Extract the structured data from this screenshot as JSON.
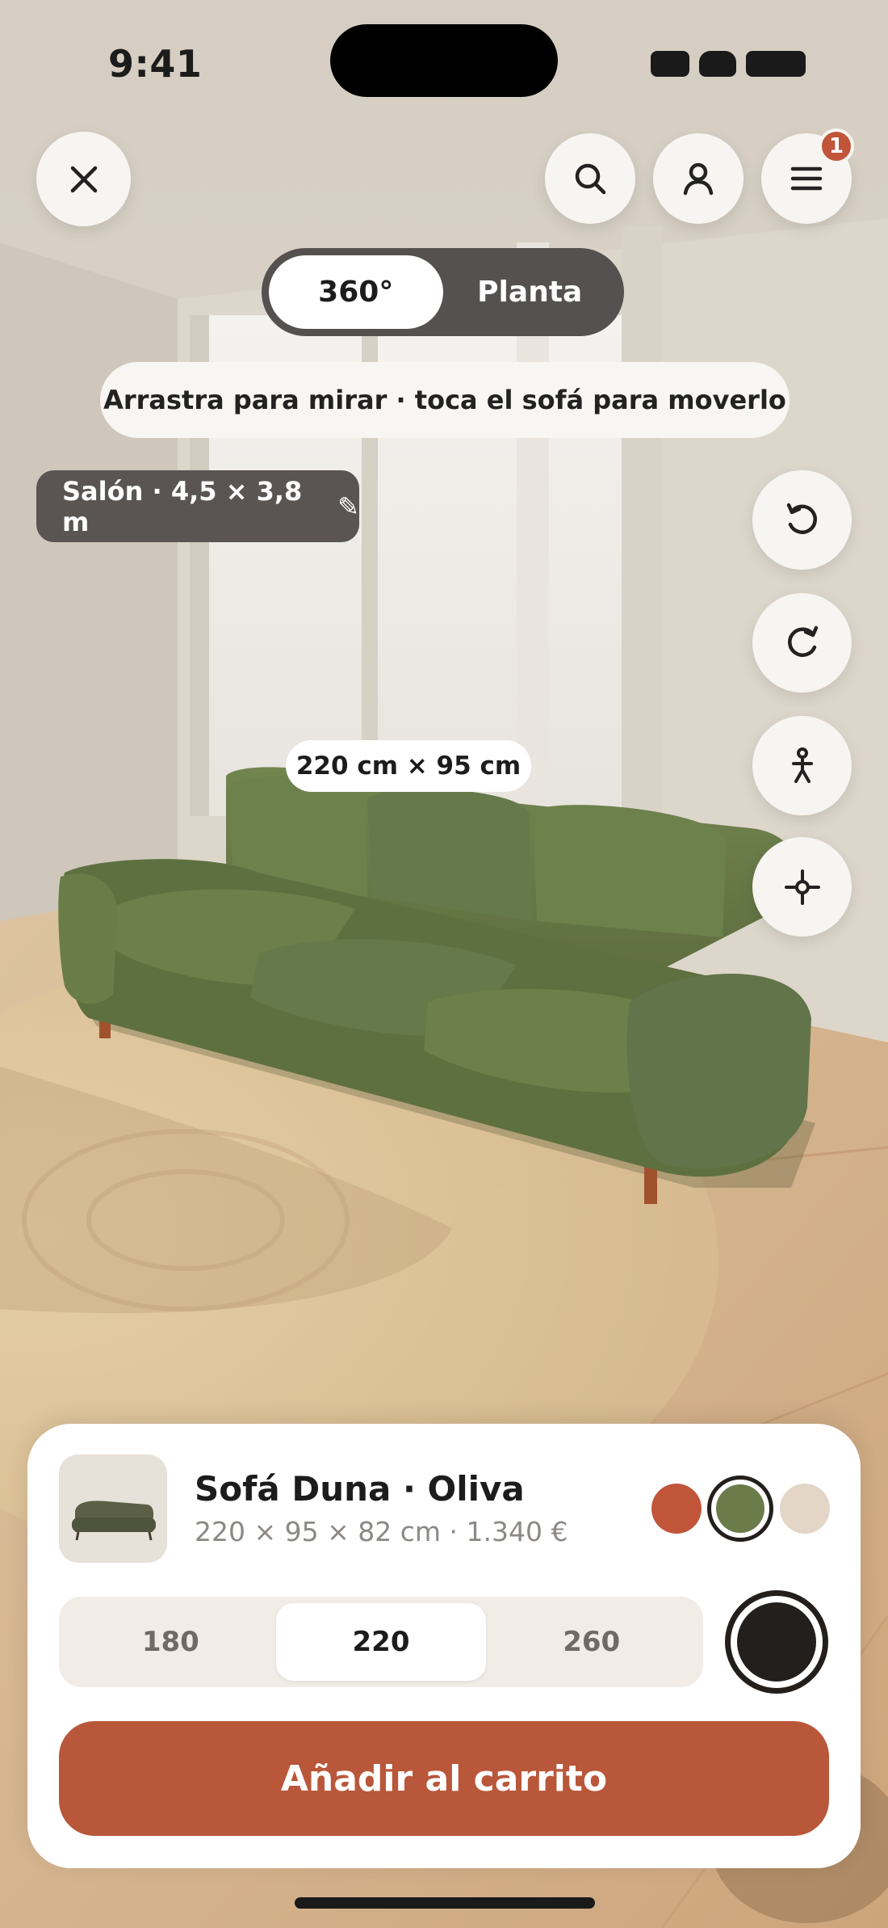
{
  "status_bar": {
    "time": "9:41"
  },
  "top_bar": {
    "notification_count": "1"
  },
  "view_toggle": {
    "options": [
      "360°",
      "Planta"
    ],
    "selected": "360°"
  },
  "hint": "Arrastra para mirar · toca el sofá para moverlo",
  "room": {
    "label": "Salón · 4,5 × 3,8 m",
    "edit_icon": "✎"
  },
  "dimension_tag": "220 cm × 95 cm",
  "side_tools": [
    "rotate-left-icon",
    "rotate-right-icon",
    "person-scale-icon",
    "recenter-icon"
  ],
  "product": {
    "name": "Sofá Duna · Oliva",
    "meta": "220 × 95 × 82 cm · 1.340 €",
    "colors": [
      {
        "name": "terracotta",
        "hex": "#c1553a",
        "selected": false
      },
      {
        "name": "oliva",
        "hex": "#6b7c4a",
        "selected": true
      },
      {
        "name": "arena",
        "hex": "#e3d6c6",
        "selected": false
      }
    ]
  },
  "sizes": {
    "options": [
      "180",
      "220",
      "260"
    ],
    "selected": "220"
  },
  "add_to_cart": "Añadir al carrito",
  "colors": {
    "accent": "#b9573a",
    "sofa": "#6b7c4a",
    "dark": "#231f1d"
  }
}
